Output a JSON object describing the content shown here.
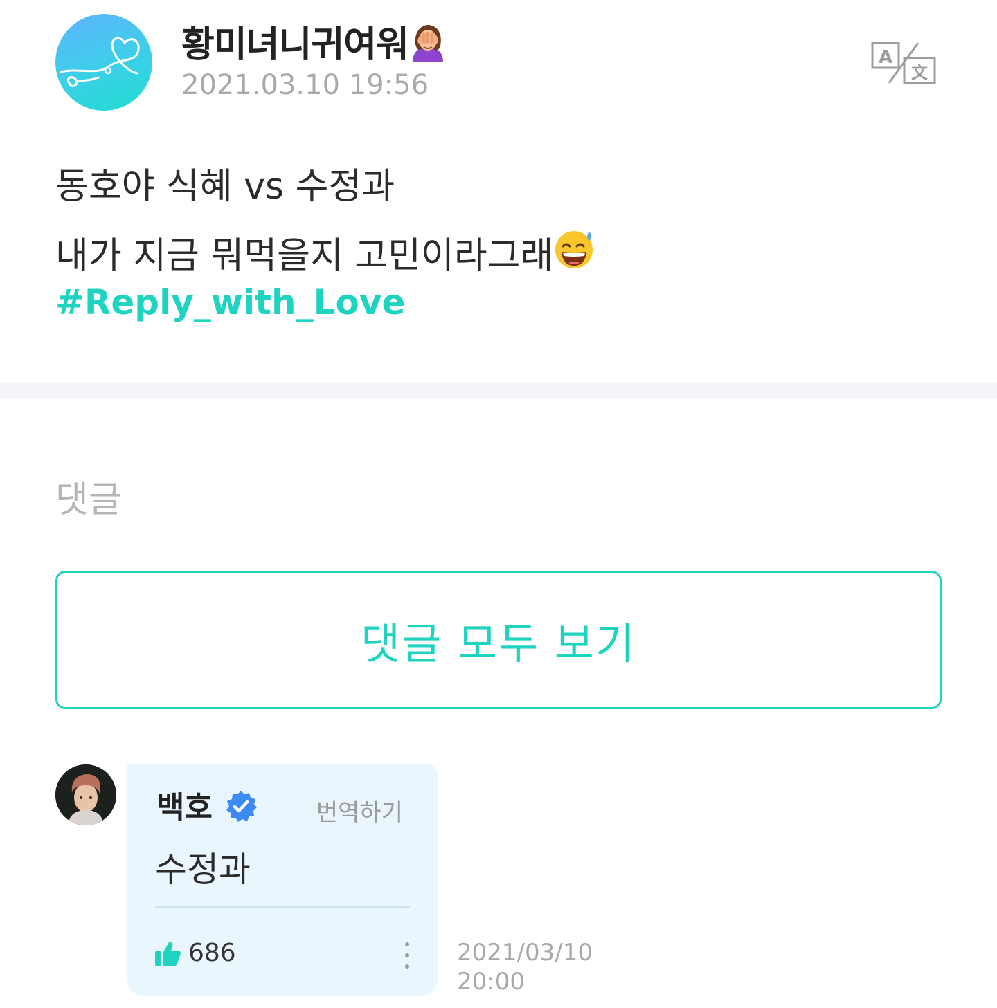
{
  "post": {
    "author": "황미녀니귀여워",
    "author_emoji": "facepalm-woman-emoji",
    "date": "2021.03.10 19:56",
    "translate_icon": "translate-icon",
    "lines": [
      "동호야 식혜 vs 수정과",
      "내가 지금 뭐먹을지 고민이라그래"
    ],
    "line2_emoji": "grinning-sweat-emoji",
    "hashtag": "#Reply_with_Love"
  },
  "comments": {
    "section_title": "댓글",
    "view_all_label": "댓글 모두 보기",
    "items": [
      {
        "author": "백호",
        "verified": true,
        "translate_label": "번역하기",
        "text": "수정과",
        "likes": "686",
        "date_line1": "2021/03/10",
        "date_line2": "20:00"
      }
    ]
  },
  "colors": {
    "accent": "#1fd3c1",
    "bubble": "#eaf6fd",
    "muted_text": "#a9a9a9",
    "divider_band": "#f4f5f8",
    "verified_blue": "#3d8bf2"
  }
}
